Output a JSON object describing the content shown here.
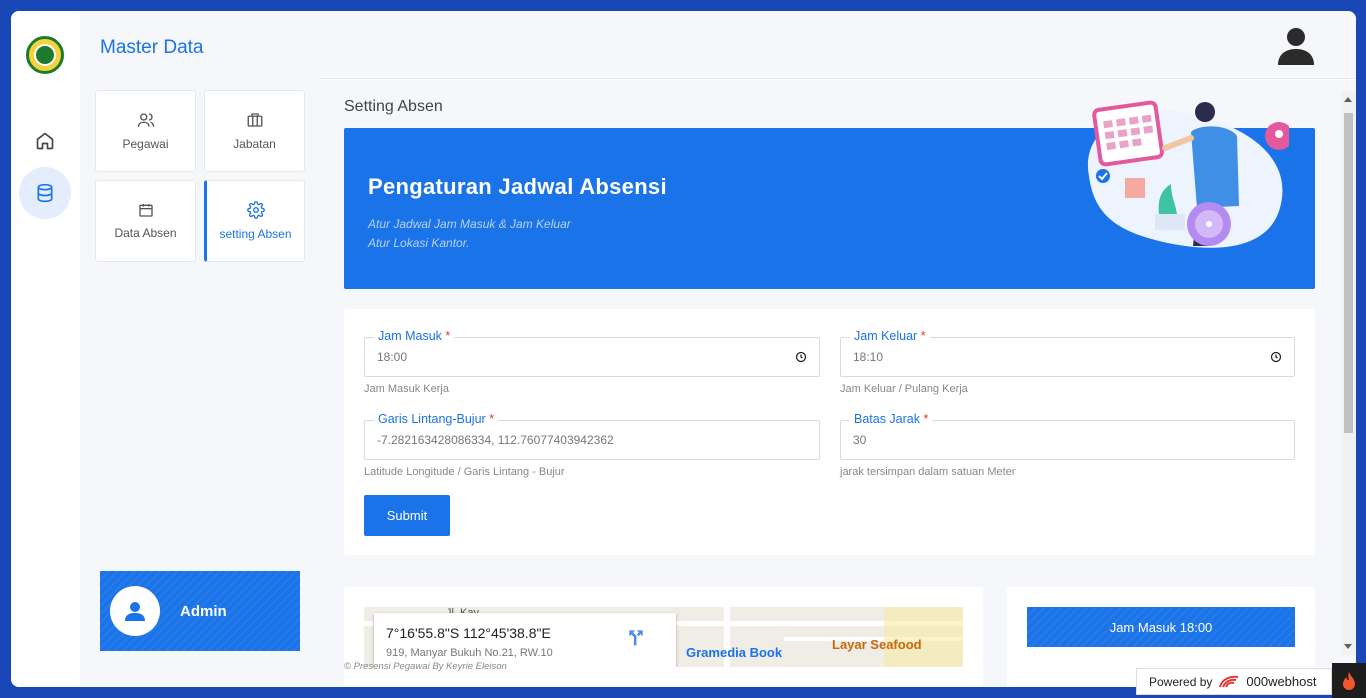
{
  "menu": {
    "title": "Master Data",
    "tiles": [
      {
        "label": "Pegawai",
        "icon": "users-icon"
      },
      {
        "label": "Jabatan",
        "icon": "briefcase-icon"
      },
      {
        "label": "Data Absen",
        "icon": "calendar-icon"
      },
      {
        "label": "setting Absen",
        "icon": "gear-icon",
        "active": true
      }
    ],
    "admin_label": "Admin"
  },
  "page": {
    "title": "Setting Absen"
  },
  "banner": {
    "title": "Pengaturan Jadwal Absensi",
    "subtitle_1": "Atur Jadwal Jam Masuk & Jam Keluar",
    "subtitle_2": "Atur Lokasi Kantor."
  },
  "form": {
    "jam_masuk": {
      "label": "Jam Masuk",
      "value": "18:00",
      "help": "Jam Masuk Kerja"
    },
    "jam_keluar": {
      "label": "Jam Keluar",
      "value": "18:10",
      "help": "Jam Keluar / Pulang Kerja"
    },
    "lokasi": {
      "label": "Garis Lintang-Bujur",
      "value": "-7.282163428086334, 112.76077403942362",
      "help": "Latitude Longitude / Garis Lintang - Bujur"
    },
    "jarak": {
      "label": "Batas Jarak",
      "value": "30",
      "help": "jarak tersimpan dalam satuan Meter"
    },
    "required_mark": "*",
    "submit_label": "Submit"
  },
  "map": {
    "coord": "7°16'55.8\"S 112°45'38.8\"E",
    "address": "919, Manyar Bukuh No.21, RW.10",
    "street": "Jl. Kay...",
    "place_1": "Layar Seafood",
    "place_2": "Gramedia Book"
  },
  "info": {
    "jam_masuk_button": "Jam Masuk 18:00"
  },
  "footer": "© Presensi Pegawai By Keyrie Eleison",
  "powered": {
    "prefix": "Powered by",
    "brand": "000webhost"
  },
  "colors": {
    "primary": "#1a73e8",
    "frame": "#1a47b8",
    "required": "#e53935"
  }
}
